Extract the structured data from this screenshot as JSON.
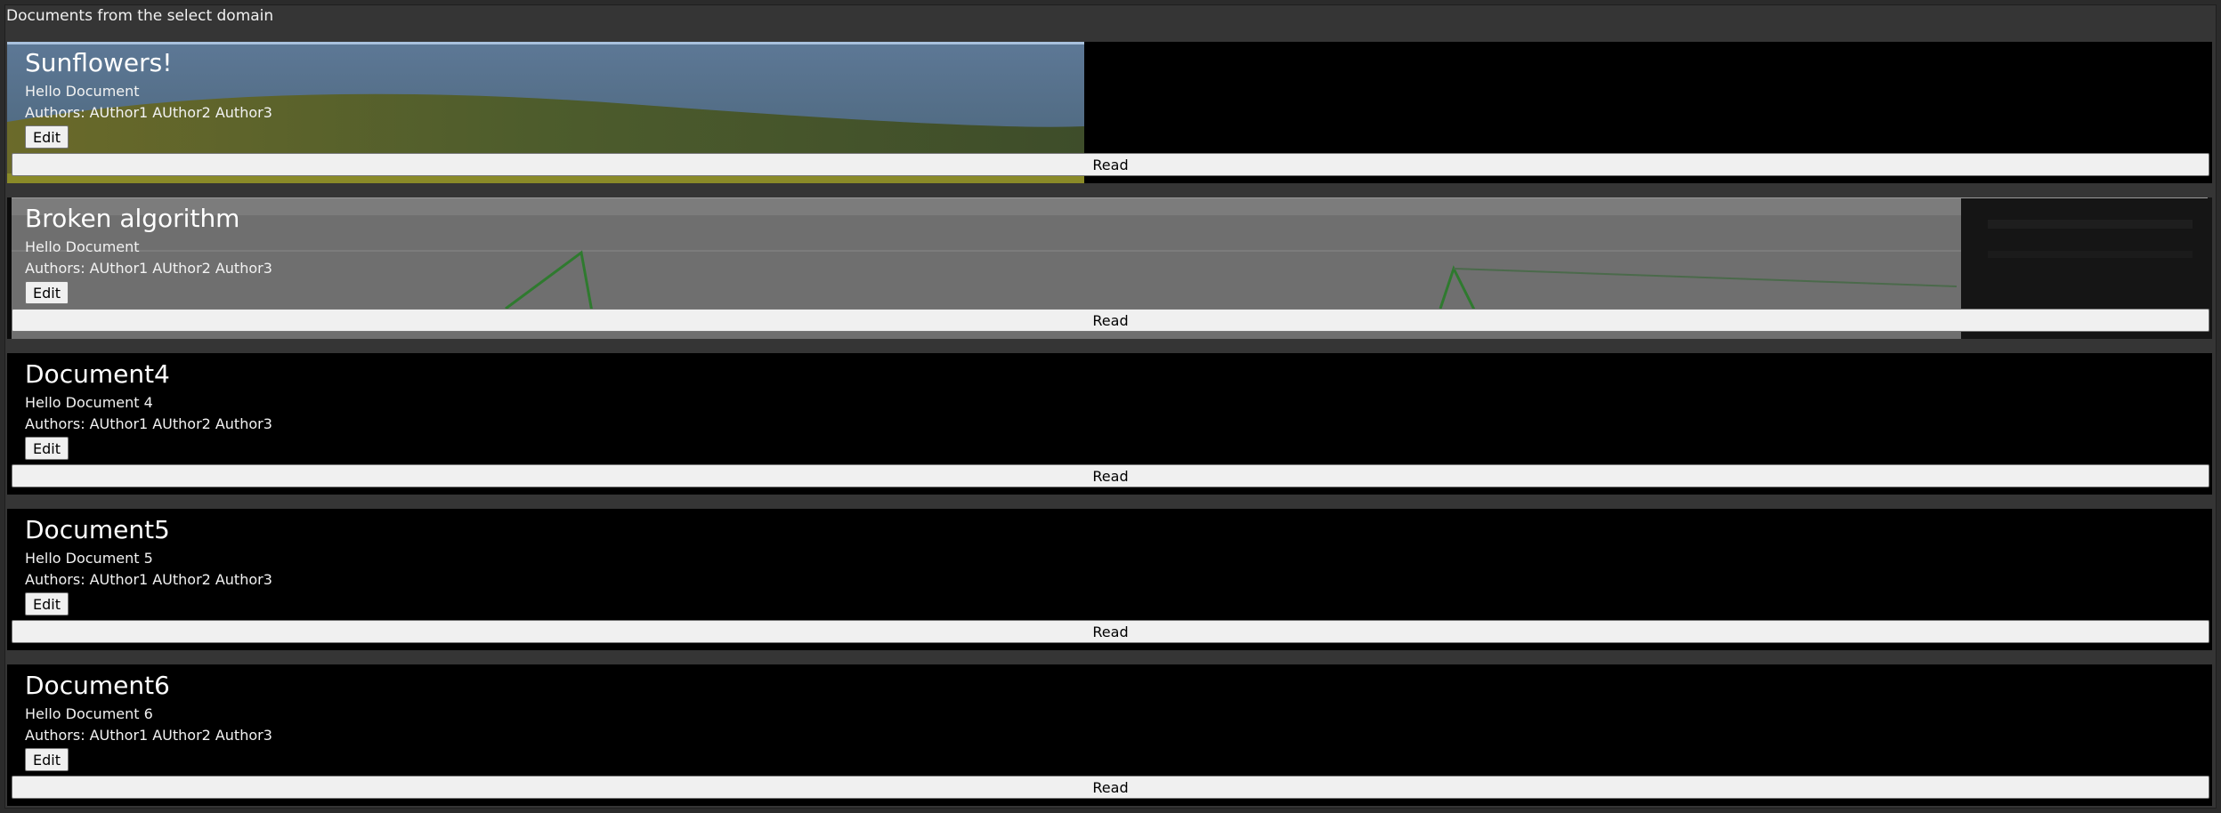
{
  "header": {
    "title": "Documents from the select domain"
  },
  "documents": [
    {
      "title": "Sunflowers!",
      "description": "Hello Document",
      "authors_label": "Authors:",
      "authors": [
        "AUthor1",
        "AUthor2",
        "Author3"
      ],
      "edit_label": "Edit",
      "read_label": "Read",
      "background": "sunflower-field-image"
    },
    {
      "title": "Broken algorithm",
      "description": "Hello Document",
      "authors_label": "Authors:",
      "authors": [
        "AUthor1",
        "AUthor2",
        "Author3"
      ],
      "edit_label": "Edit",
      "read_label": "Read",
      "background": "graph-screenshot-image"
    },
    {
      "title": "Document4",
      "description": "Hello Document 4",
      "authors_label": "Authors:",
      "authors": [
        "AUthor1",
        "AUthor2",
        "Author3"
      ],
      "edit_label": "Edit",
      "read_label": "Read"
    },
    {
      "title": "Document5",
      "description": "Hello Document 5",
      "authors_label": "Authors:",
      "authors": [
        "AUthor1",
        "AUthor2",
        "Author3"
      ],
      "edit_label": "Edit",
      "read_label": "Read"
    },
    {
      "title": "Document6",
      "description": "Hello Document 6",
      "authors_label": "Authors:",
      "authors": [
        "AUthor1",
        "AUthor2",
        "Author3"
      ],
      "edit_label": "Edit",
      "read_label": "Read"
    }
  ]
}
